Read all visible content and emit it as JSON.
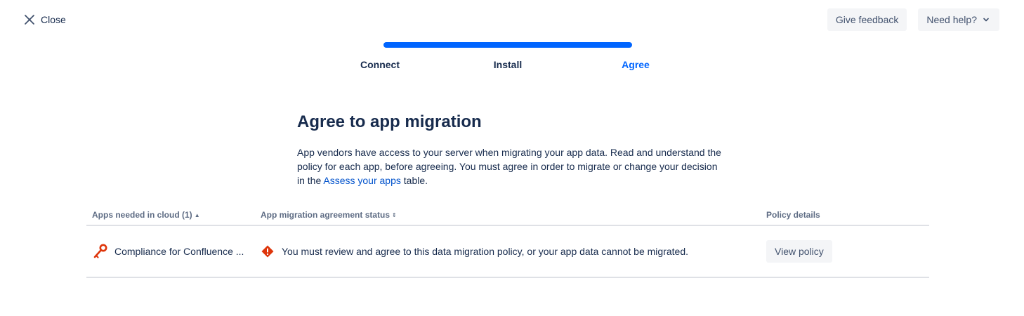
{
  "header": {
    "close_label": "Close",
    "feedback_label": "Give feedback",
    "help_label": "Need help?"
  },
  "progress": {
    "steps": [
      {
        "label": "Connect",
        "active": false
      },
      {
        "label": "Install",
        "active": false
      },
      {
        "label": "Agree",
        "active": true
      }
    ],
    "fill_fraction": 1.0,
    "accent_color": "#0065FF"
  },
  "content": {
    "title": "Agree to app migration",
    "description_before": "App vendors have access to your server when migrating your app data. Read and understand the policy for each app, before agreeing. You must agree in order to migrate or change your decision in the ",
    "description_link": "Assess your apps",
    "description_after": " table."
  },
  "table": {
    "headers": {
      "apps": "Apps needed in cloud (1)",
      "status": "App migration agreement status",
      "policy": "Policy details"
    },
    "rows": [
      {
        "app_name": "Compliance for Confluence ...",
        "app_icon": "key-icon",
        "status_icon": "warning-diamond-icon",
        "status_text": "You must review and agree to this data migration policy, or your app data cannot be migrated.",
        "action_label": "View policy"
      }
    ]
  },
  "colors": {
    "brand_blue": "#0065FF",
    "link_blue": "#0052CC",
    "warning_red": "#DE350B",
    "text": "#172B4D"
  }
}
